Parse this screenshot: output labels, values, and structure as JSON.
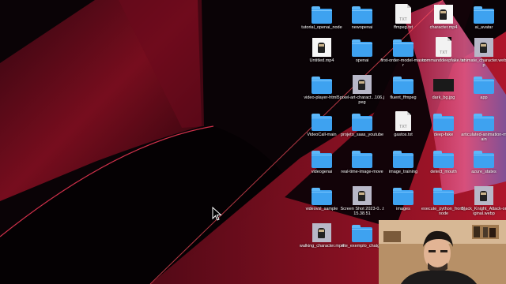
{
  "desktop": {
    "items": [
      {
        "label": "tutorial_openai_node",
        "kind": "folder"
      },
      {
        "label": "newopenai",
        "kind": "folder"
      },
      {
        "label": "ffmpeg.txt",
        "kind": "text"
      },
      {
        "label": "character.mp4",
        "kind": "video-thumb"
      },
      {
        "label": "ai_avatar",
        "kind": "folder"
      },
      {
        "label": "Untitled.mp4",
        "kind": "video-thumb"
      },
      {
        "label": "openai",
        "kind": "folder"
      },
      {
        "label": "first-order-model-master",
        "kind": "folder"
      },
      {
        "label": "commanddeepfake.txt",
        "kind": "text"
      },
      {
        "label": "animate_character.webp",
        "kind": "image-thumb"
      },
      {
        "label": "video-player-html5",
        "kind": "folder"
      },
      {
        "label": "pixel-art-charact...106.jpeg",
        "kind": "image-thumb"
      },
      {
        "label": "fluent_ffmpeg",
        "kind": "folder"
      },
      {
        "label": "dark_bg.jpg",
        "kind": "dark-thumb"
      },
      {
        "label": "app",
        "kind": "folder"
      },
      {
        "label": "VideoCall-main",
        "kind": "folder"
      },
      {
        "label": "projeto_saas_youtube",
        "kind": "folder"
      },
      {
        "label": "gastos.txt",
        "kind": "text"
      },
      {
        "label": "deep-fake",
        "kind": "folder"
      },
      {
        "label": "articulated-animation-main",
        "kind": "folder"
      },
      {
        "label": "videogenai",
        "kind": "folder"
      },
      {
        "label": "real-time-image-move",
        "kind": "folder"
      },
      {
        "label": "image_training",
        "kind": "folder"
      },
      {
        "label": "detect_mouth",
        "kind": "folder"
      },
      {
        "label": "azure_states",
        "kind": "folder"
      },
      {
        "label": "videovsl_sample",
        "kind": "folder"
      },
      {
        "label": "Screen Shot 2023-0...t 15.38.51",
        "kind": "image-thumb"
      },
      {
        "label": "images",
        "kind": "folder"
      },
      {
        "label": "execute_python_from_node",
        "kind": "folder"
      },
      {
        "label": "Black_Knight_Attack-original.webp",
        "kind": "image-thumb"
      },
      {
        "label": "walking_character.mp4",
        "kind": "image-thumb"
      },
      {
        "label": "site_exemplo_chatgpt",
        "kind": "folder"
      }
    ],
    "txt_badge": "TXT"
  },
  "colors": {
    "wallpaper_red": "#c0182f",
    "folder_blue": "#3ea2f0"
  }
}
